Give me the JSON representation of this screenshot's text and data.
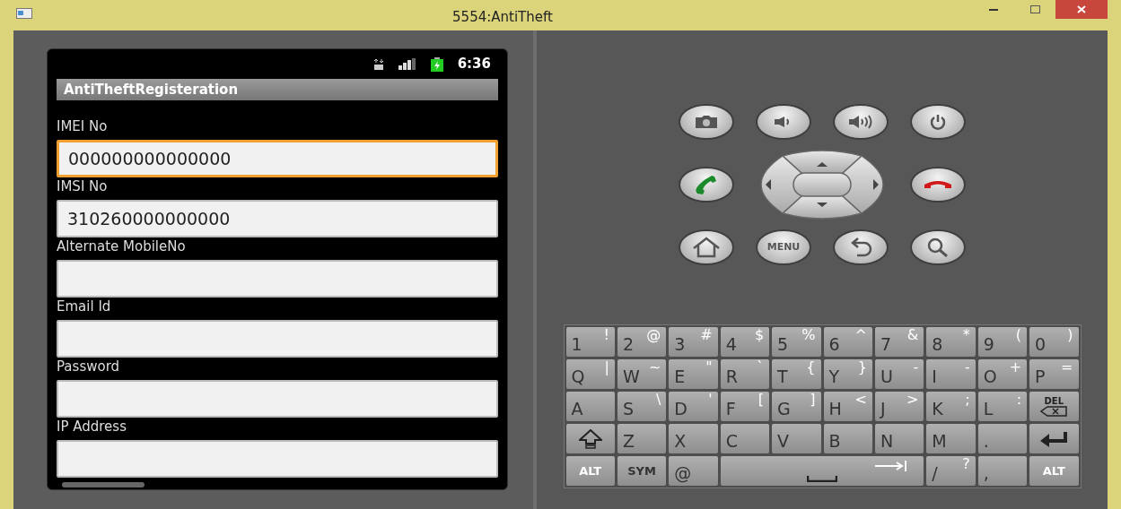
{
  "window": {
    "title": "5554:AntiTheft"
  },
  "status_bar": {
    "time": "6:36"
  },
  "app": {
    "title": "AntiTheftRegisteration"
  },
  "fields": [
    {
      "label": "IMEI No",
      "value": "000000000000000",
      "focused": true
    },
    {
      "label": "IMSI No",
      "value": "310260000000000",
      "focused": false
    },
    {
      "label": "Alternate MobileNo",
      "focused": false
    },
    {
      "label": "Email Id",
      "focused": false
    },
    {
      "label": "Password",
      "focused": false
    },
    {
      "label": "IP Address",
      "focused": false
    }
  ],
  "hardware_buttons": [
    [
      {
        "kind": "camera"
      },
      {
        "kind": "volume_down"
      },
      {
        "kind": "volume_up"
      },
      {
        "kind": "power"
      }
    ],
    [
      {
        "kind": "call"
      },
      {
        "kind": "dpad"
      },
      {
        "kind": "end_call"
      }
    ],
    [
      {
        "kind": "home"
      },
      {
        "kind": "menu",
        "label": "MENU"
      },
      {
        "kind": "back"
      },
      {
        "kind": "search"
      }
    ]
  ],
  "keyboard": {
    "rows": [
      [
        {
          "kind": "char",
          "main": "1",
          "alt": "!"
        },
        {
          "kind": "char",
          "main": "2",
          "alt": "@"
        },
        {
          "kind": "char",
          "main": "3",
          "alt": "#"
        },
        {
          "kind": "char",
          "main": "4",
          "alt": "$"
        },
        {
          "kind": "char",
          "main": "5",
          "alt": "%"
        },
        {
          "kind": "char",
          "main": "6",
          "alt": "^"
        },
        {
          "kind": "char",
          "main": "7",
          "alt": "&"
        },
        {
          "kind": "char",
          "main": "8",
          "alt": "*"
        },
        {
          "kind": "char",
          "main": "9",
          "alt": "("
        },
        {
          "kind": "char",
          "main": "0",
          "alt": ")"
        }
      ],
      [
        {
          "kind": "char",
          "main": "Q",
          "alt": "|"
        },
        {
          "kind": "char",
          "main": "W",
          "alt": "~"
        },
        {
          "kind": "char",
          "main": "E",
          "alt": "\""
        },
        {
          "kind": "char",
          "main": "R",
          "alt": "`"
        },
        {
          "kind": "char",
          "main": "T",
          "alt": "{"
        },
        {
          "kind": "char",
          "main": "Y",
          "alt": "}"
        },
        {
          "kind": "char",
          "main": "U",
          "alt": "-"
        },
        {
          "kind": "char",
          "main": "I",
          "alt": "-"
        },
        {
          "kind": "char",
          "main": "O",
          "alt": "+"
        },
        {
          "kind": "char",
          "main": "P",
          "alt": "="
        }
      ],
      [
        {
          "kind": "char",
          "main": "A"
        },
        {
          "kind": "char",
          "main": "S",
          "alt": "\\"
        },
        {
          "kind": "char",
          "main": "D",
          "alt": "'"
        },
        {
          "kind": "char",
          "main": "F",
          "alt": "["
        },
        {
          "kind": "char",
          "main": "G",
          "alt": "]"
        },
        {
          "kind": "char",
          "main": "H",
          "alt": "<"
        },
        {
          "kind": "char",
          "main": "J",
          "alt": ">"
        },
        {
          "kind": "char",
          "main": "K",
          "alt": ";"
        },
        {
          "kind": "char",
          "main": "L",
          "alt": ":"
        },
        {
          "kind": "del",
          "label": "DEL"
        }
      ],
      [
        {
          "kind": "shift"
        },
        {
          "kind": "char",
          "main": "Z"
        },
        {
          "kind": "char",
          "main": "X"
        },
        {
          "kind": "char",
          "main": "C"
        },
        {
          "kind": "char",
          "main": "V"
        },
        {
          "kind": "char",
          "main": "B"
        },
        {
          "kind": "char",
          "main": "N"
        },
        {
          "kind": "char",
          "main": "M"
        },
        {
          "kind": "char",
          "main": "."
        },
        {
          "kind": "enter"
        }
      ],
      [
        {
          "kind": "alt",
          "label": "ALT"
        },
        {
          "kind": "sym",
          "label": "SYM"
        },
        {
          "kind": "char",
          "main": "@"
        },
        {
          "kind": "space"
        },
        "",
        "",
        "",
        {
          "kind": "char",
          "main": "/",
          "alt": "?"
        },
        {
          "kind": "char",
          "main": ","
        },
        {
          "kind": "alt",
          "label": "ALT"
        }
      ]
    ]
  }
}
